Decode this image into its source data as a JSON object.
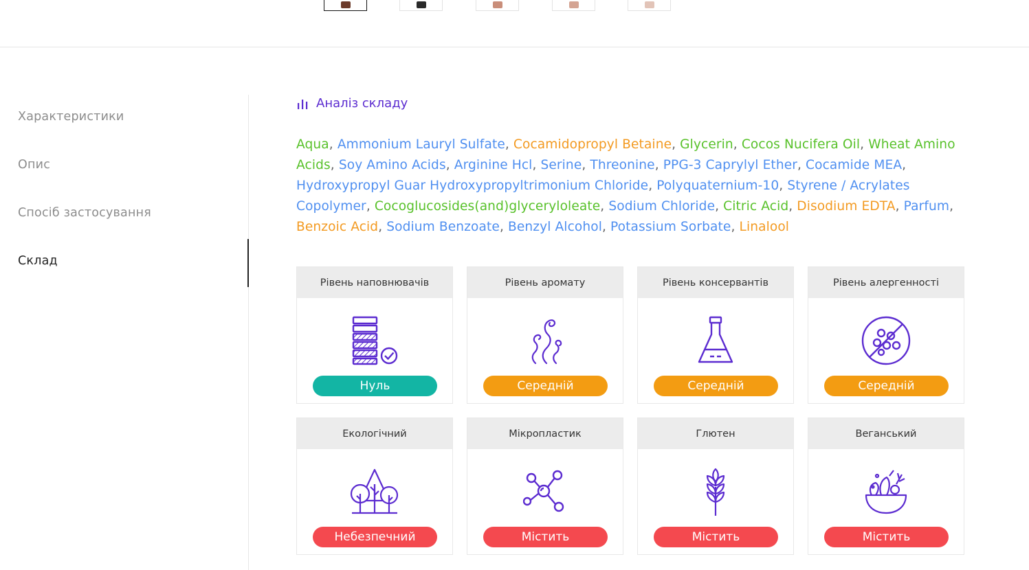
{
  "thumbnails": [
    {
      "name": "thumb-1",
      "active": true,
      "color": "#6b3a2a"
    },
    {
      "name": "thumb-2",
      "active": false,
      "color": "#2a2a2a"
    },
    {
      "name": "thumb-3",
      "active": false,
      "color": "#c98e7a"
    },
    {
      "name": "thumb-4",
      "active": false,
      "color": "#d4a493"
    },
    {
      "name": "thumb-5",
      "active": false,
      "color": "#e2c4b8"
    }
  ],
  "sidebar": {
    "items": [
      {
        "label": "Характеристики",
        "active": false
      },
      {
        "label": "Опис",
        "active": false
      },
      {
        "label": "Спосіб застосування",
        "active": false
      },
      {
        "label": "Склад",
        "active": true
      }
    ]
  },
  "analysis": {
    "label": "Аналіз складу",
    "icon": "bar-chart-icon",
    "color": "#5b2bd0"
  },
  "colors": {
    "green": "#58c12a",
    "blue": "#4f8ff0",
    "orange": "#f39a21",
    "teal": "#13b5a4",
    "amber": "#f39c12",
    "red": "#f4494f",
    "icon": "#5b2bd0"
  },
  "ingredients": [
    {
      "name": "Aqua",
      "level": "green"
    },
    {
      "name": "Ammonium Lauryl Sulfate",
      "level": "blue"
    },
    {
      "name": "Cocamidopropyl Betaine",
      "level": "orange"
    },
    {
      "name": "Glycerin",
      "level": "green"
    },
    {
      "name": "Cocos Nucifera Oil",
      "level": "green"
    },
    {
      "name": "Wheat Amino Acids",
      "level": "green"
    },
    {
      "name": "Soy Amino Acids",
      "level": "blue"
    },
    {
      "name": "Arginine Hcl",
      "level": "blue"
    },
    {
      "name": "Serine",
      "level": "blue"
    },
    {
      "name": "Threonine",
      "level": "blue"
    },
    {
      "name": "PPG-3 Caprylyl Ether",
      "level": "blue"
    },
    {
      "name": "Cocamide MEA",
      "level": "blue"
    },
    {
      "name": "Hydroxypropyl Guar Hydroxypropyltrimonium Chloride",
      "level": "blue"
    },
    {
      "name": "Polyquaternium-10",
      "level": "blue"
    },
    {
      "name": "Styrene / Acrylates Copolymer",
      "level": "blue"
    },
    {
      "name": "Cocoglucosides(and)glyceryloleate",
      "level": "green"
    },
    {
      "name": "Sodium Chloride",
      "level": "blue"
    },
    {
      "name": "Citric Acid",
      "level": "green"
    },
    {
      "name": "Disodium EDTA",
      "level": "orange"
    },
    {
      "name": "Parfum",
      "level": "blue"
    },
    {
      "name": "Benzoic Acid",
      "level": "orange"
    },
    {
      "name": "Sodium Benzoate",
      "level": "blue"
    },
    {
      "name": "Benzyl Alcohol",
      "level": "blue"
    },
    {
      "name": "Potassium Sorbate",
      "level": "blue"
    },
    {
      "name": "Linalool",
      "level": "orange"
    }
  ],
  "cards": [
    {
      "title": "Рівень наповнювачів",
      "status": "Нуль",
      "status_color": "#13b5a4",
      "icon": "filler-stack-check-icon"
    },
    {
      "title": "Рівень аромату",
      "status": "Середній",
      "status_color": "#f39c12",
      "icon": "aroma-waves-icon"
    },
    {
      "title": "Рівень консервантів",
      "status": "Середній",
      "status_color": "#f39c12",
      "icon": "flask-icon"
    },
    {
      "title": "Рівень алергенності",
      "status": "Середній",
      "status_color": "#f39c12",
      "icon": "allergen-crossed-icon"
    },
    {
      "title": "Екологічний",
      "status": "Небезпечний",
      "status_color": "#f4494f",
      "icon": "trees-icon"
    },
    {
      "title": "Мікропластик",
      "status": "Містить",
      "status_color": "#f4494f",
      "icon": "molecule-icon"
    },
    {
      "title": "Глютен",
      "status": "Містить",
      "status_color": "#f4494f",
      "icon": "wheat-icon"
    },
    {
      "title": "Веганський",
      "status": "Містить",
      "status_color": "#f4494f",
      "icon": "salad-bowl-icon"
    }
  ]
}
